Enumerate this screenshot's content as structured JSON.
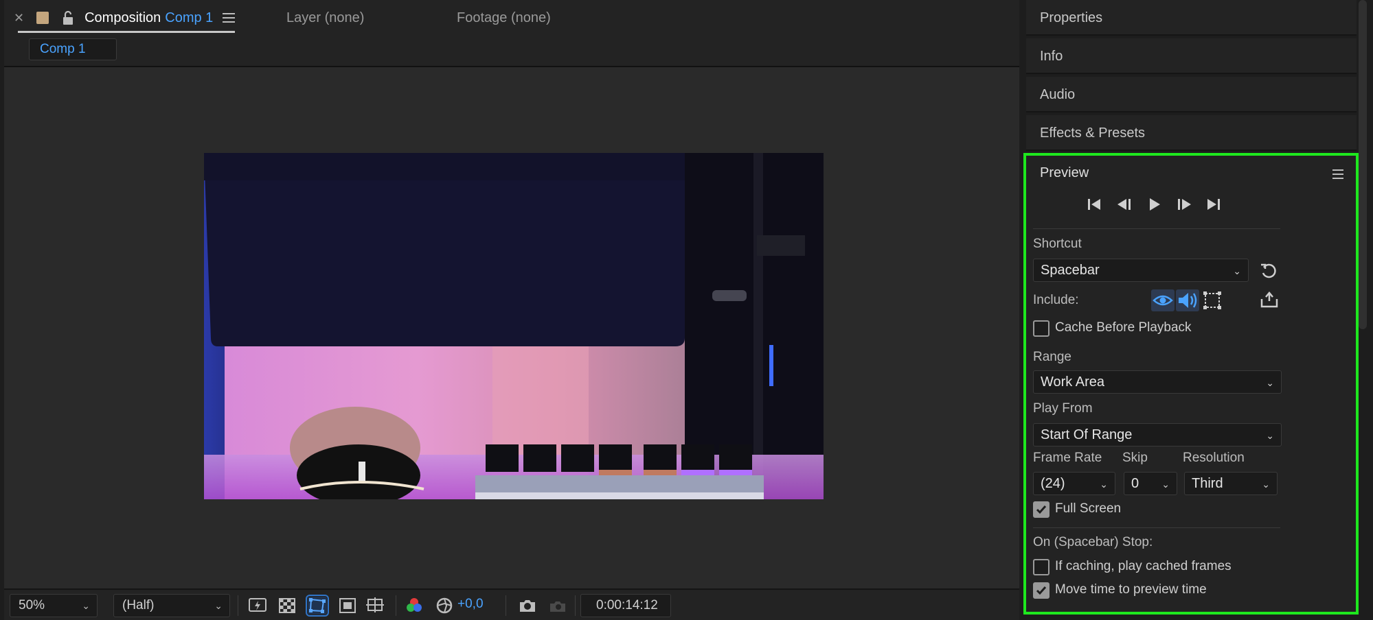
{
  "composition_panel": {
    "tab_title": "Composition",
    "tab_name": "Comp 1",
    "layer_tab": "Layer (none)",
    "footage_tab": "Footage (none)",
    "subtab": "Comp 1"
  },
  "bottom_bar": {
    "zoom": "50%",
    "resolution": "(Half)",
    "exposure": "+0,0",
    "timecode": "0:00:14:12"
  },
  "right_panels": {
    "properties": "Properties",
    "info": "Info",
    "audio": "Audio",
    "effects": "Effects & Presets"
  },
  "preview": {
    "title": "Preview",
    "shortcut_label": "Shortcut",
    "shortcut_value": "Spacebar",
    "include_label": "Include:",
    "cache_before_playback": "Cache Before Playback",
    "cache_checked": false,
    "range_label": "Range",
    "range_value": "Work Area",
    "play_from_label": "Play From",
    "play_from_value": "Start Of Range",
    "frame_rate_label": "Frame Rate",
    "frame_rate_value": "(24)",
    "skip_label": "Skip",
    "skip_value": "0",
    "resolution_label": "Resolution",
    "resolution_value": "Third",
    "full_screen": "Full Screen",
    "full_screen_checked": true,
    "on_stop_label": "On (Spacebar) Stop:",
    "if_caching": "If caching, play cached frames",
    "if_caching_checked": false,
    "move_time": "Move time to preview time",
    "move_time_checked": true
  },
  "colors": {
    "accent_blue": "#4aa3ff",
    "highlight_green": "#1ee81e",
    "panel_bg": "#232323"
  }
}
